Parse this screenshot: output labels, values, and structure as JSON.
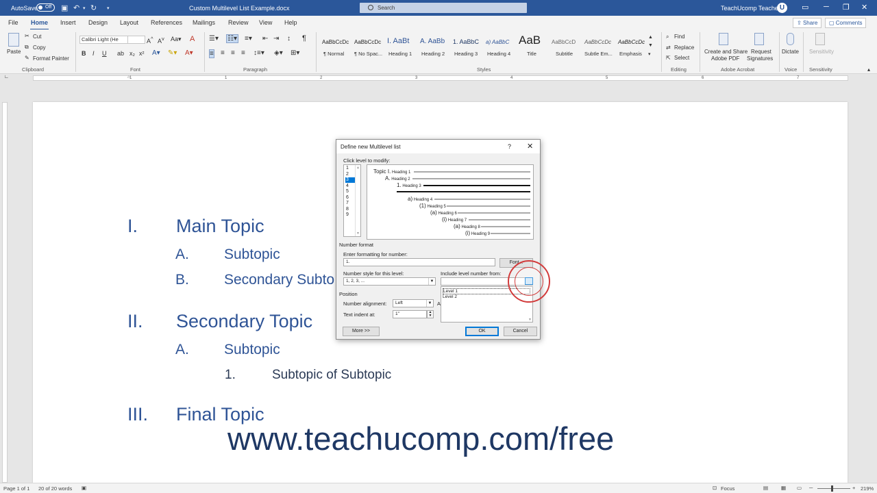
{
  "titlebar": {
    "autosave": "AutoSave",
    "autosave_state": "Off",
    "doc_title": "Custom Multilevel List Example.docx",
    "search_placeholder": "Search",
    "user": "TeachUcomp Teacher",
    "avatar": "U"
  },
  "tabs": [
    "File",
    "Home",
    "Insert",
    "Design",
    "Layout",
    "References",
    "Mailings",
    "Review",
    "View",
    "Help"
  ],
  "active_tab": "Home",
  "share_label": "Share",
  "comments_label": "Comments",
  "ribbon": {
    "clipboard": {
      "label": "Clipboard",
      "paste": "Paste",
      "cut": "Cut",
      "copy": "Copy",
      "format_painter": "Format Painter"
    },
    "font": {
      "label": "Font",
      "font_name": "Calibri Light (He",
      "bold": "B",
      "italic": "I",
      "underline": "U"
    },
    "paragraph": {
      "label": "Paragraph"
    },
    "styles": {
      "label": "Styles",
      "items": [
        {
          "preview": "AaBbCcDc",
          "name": "¶ Normal"
        },
        {
          "preview": "AaBbCcDc",
          "name": "¶ No Spac..."
        },
        {
          "preview": "I.  AaBt",
          "name": "Heading 1"
        },
        {
          "preview": "A.  AaBb",
          "name": "Heading 2"
        },
        {
          "preview": "1.  AaBbC",
          "name": "Heading 3"
        },
        {
          "preview": "a)  AaBbC",
          "name": "Heading 4"
        },
        {
          "preview": "AaB",
          "name": "Title"
        },
        {
          "preview": "AaBbCcD",
          "name": "Subtitle"
        },
        {
          "preview": "AaBbCcDc",
          "name": "Subtle Em..."
        },
        {
          "preview": "AaBbCcDc",
          "name": "Emphasis"
        }
      ]
    },
    "editing": {
      "label": "Editing",
      "find": "Find",
      "replace": "Replace",
      "select": "Select"
    },
    "acrobat": {
      "label": "Adobe Acrobat",
      "create_share_1": "Create and Share",
      "create_share_2": "Adobe PDF",
      "request_1": "Request",
      "request_2": "Signatures"
    },
    "voice": {
      "label": "Voice",
      "dictate": "Dictate"
    },
    "sensitivity": {
      "label": "Sensitivity",
      "button": "Sensitivity"
    }
  },
  "ruler_numbers": [
    "1",
    "1",
    "2",
    "3",
    "4",
    "5",
    "6",
    "7"
  ],
  "document": {
    "items": [
      {
        "num": "I.",
        "text": "Main Topic"
      },
      {
        "num": "A.",
        "text": "Subtopic"
      },
      {
        "num": "B.",
        "text": "Secondary Subto"
      },
      {
        "num": "II.",
        "text": "Secondary Topic"
      },
      {
        "num": "A.",
        "text": "Subtopic"
      },
      {
        "num": "1.",
        "text": "Subtopic of Subtopic"
      },
      {
        "num": "III.",
        "text": "Final Topic"
      }
    ]
  },
  "watermark": "www.teachucomp.com/free",
  "dialog": {
    "title": "Define new Multilevel list",
    "help": "?",
    "close": "✕",
    "click_level_label": "Click level to modify:",
    "levels": [
      "1",
      "2",
      "3",
      "4",
      "5",
      "6",
      "7",
      "8",
      "9"
    ],
    "selected_level": "3",
    "preview": [
      {
        "num": "Topic I.",
        "label": "Heading 1"
      },
      {
        "num": "A.",
        "label": "Heading 2"
      },
      {
        "num": "1.",
        "label": "Heading 3"
      },
      {
        "num": "a)",
        "label": "Heading 4"
      },
      {
        "num": "(1)",
        "label": "Heading 5"
      },
      {
        "num": "(a)",
        "label": "Heading 6"
      },
      {
        "num": "(i)",
        "label": "Heading 7"
      },
      {
        "num": "(a)",
        "label": "Heading 8"
      },
      {
        "num": "(i)",
        "label": "Heading 9"
      }
    ],
    "number_format_label": "Number format",
    "enter_formatting_label": "Enter formatting for number:",
    "format_value": "1.",
    "font_button": "Font...",
    "number_style_label": "Number style for this level:",
    "number_style_value": "1, 2, 3, ...",
    "include_level_label": "Include level number from:",
    "include_value": "",
    "include_options": [
      "Level 1",
      "Level 2"
    ],
    "position_label": "Position",
    "alignment_label": "Number alignment:",
    "alignment_value": "Left",
    "aligned_at_short": "A",
    "text_indent_label": "Text indent at:",
    "text_indent_value": "1\"",
    "more_button": "More >>",
    "ok_button": "OK",
    "cancel_button": "Cancel"
  },
  "statusbar": {
    "page": "Page 1 of 1",
    "words": "20 of 20 words",
    "focus": "Focus",
    "zoom": "219%"
  }
}
